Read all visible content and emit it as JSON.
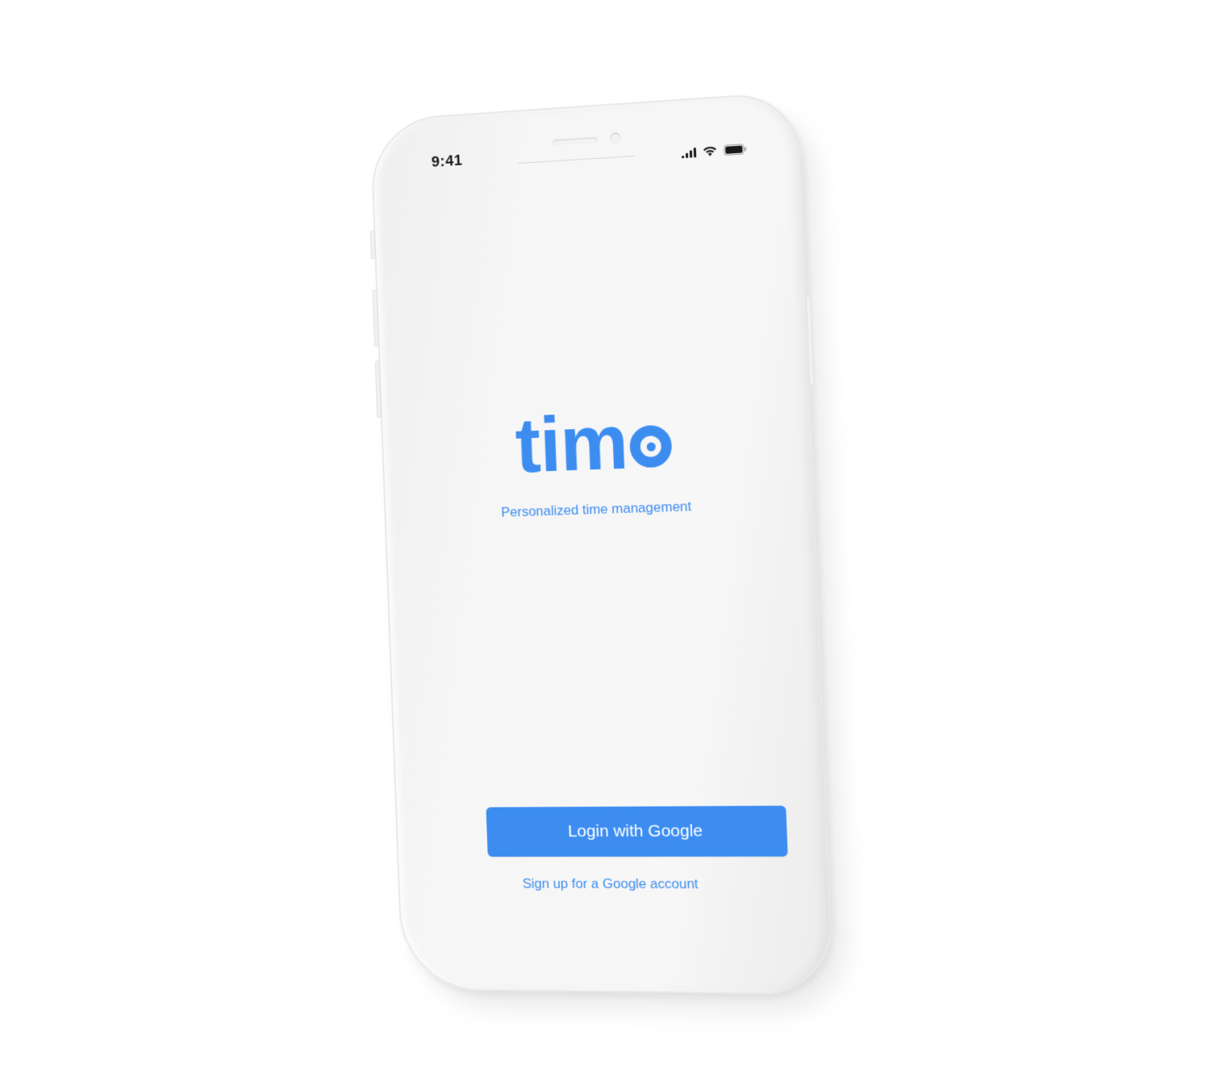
{
  "status_bar": {
    "time": "9:41",
    "icons": [
      "signal-icon",
      "wifi-icon",
      "battery-icon"
    ]
  },
  "brand": {
    "logo_text": "tim",
    "logo_full": "timo",
    "tagline": "Personalized time management"
  },
  "actions": {
    "login_label": "Login with Google",
    "signup_label": "Sign up for a Google account"
  },
  "colors": {
    "accent": "#3d8df1",
    "screen_background": "#f4f4f4",
    "status_text": "#1a1a1a"
  }
}
